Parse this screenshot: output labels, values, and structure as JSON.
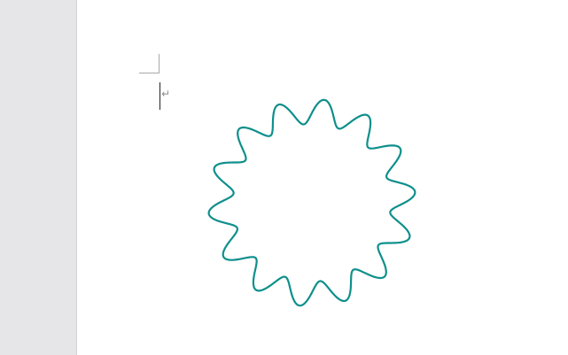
{
  "document": {
    "paragraph_mark": "↵"
  },
  "shape": {
    "type": "wave-star",
    "points": 14,
    "outline_color": "#0e8f8c",
    "fill": "none"
  },
  "colors": {
    "gutter": "#e6e6e9",
    "page": "#ffffff"
  }
}
